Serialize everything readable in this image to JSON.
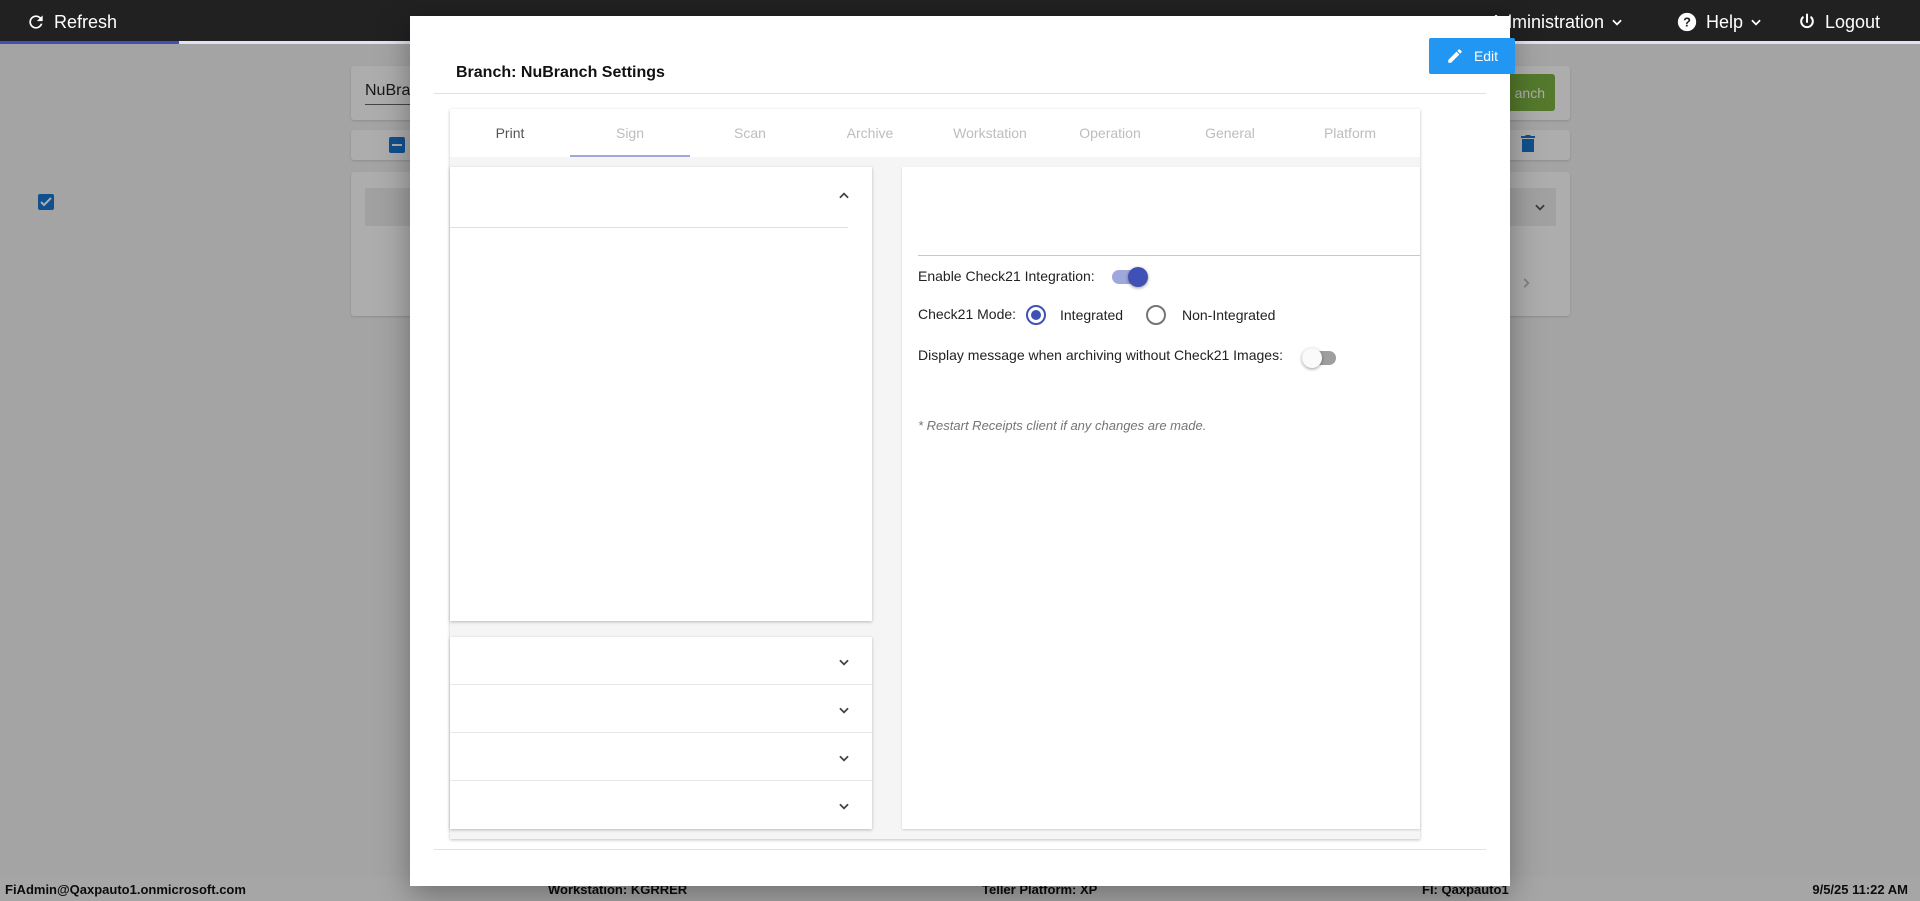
{
  "topbar": {
    "refresh_label": "Refresh",
    "admin_label": "Administration",
    "help_label": "Help",
    "logout_label": "Logout",
    "loading_progress_percent": 9.3
  },
  "background": {
    "search_text": "NuBra",
    "green_button_label": "anch"
  },
  "modal": {
    "title": "Branch: NuBranch Settings",
    "edit_label": "Edit",
    "tabs": [
      {
        "label": "Print"
      },
      {
        "label": "Sign"
      },
      {
        "label": "Scan"
      },
      {
        "label": "Archive"
      },
      {
        "label": "Workstation"
      },
      {
        "label": "Operation"
      },
      {
        "label": "General"
      },
      {
        "label": "Platform"
      }
    ],
    "settings": {
      "check21_label": "Enable Check21 Integration:",
      "check21_enabled": true,
      "mode_label": "Check21 Mode:",
      "mode_options": [
        "Integrated",
        "Non-Integrated"
      ],
      "mode_selected": "Integrated",
      "display_msg_label": "Display message when archiving without Check21 Images:",
      "display_msg_enabled": false,
      "note": "* Restart Receipts client if any changes are made."
    }
  },
  "footer": {
    "user": "FiAdmin@Qaxpauto1.onmicrosoft.com",
    "workstation": "Workstation: KGRRER",
    "teller_platform": "Teller Platform: XP",
    "fi": "FI: Qaxpauto1",
    "datetime": "9/5/25 11:22 AM"
  },
  "colors": {
    "primary": "#3f51b5",
    "edit_button": "#2196f3",
    "green": "#7cb342",
    "topbar": "#212121"
  }
}
